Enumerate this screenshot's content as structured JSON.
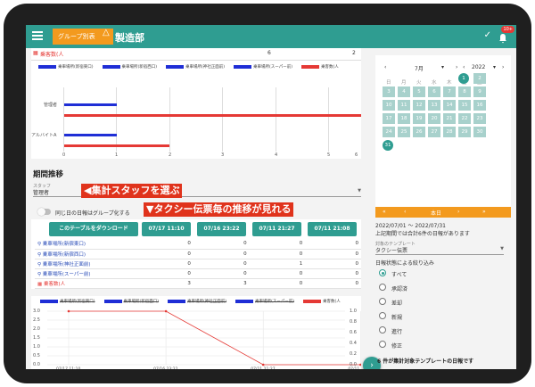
{
  "header": {
    "group_toggle_label": "グループ別表",
    "title": "製造部",
    "notification_count": "10+"
  },
  "top_table": {
    "row_label": "乗客数(人",
    "row_values": [
      "6",
      "2"
    ]
  },
  "bar_chart": {
    "legend": [
      "乗車場所(新宿東口)",
      "乗車場所(新宿西口)",
      "乗車場所(神社正面前)",
      "乗車場所(スーパー前)",
      "乗客数(人"
    ],
    "categories": [
      "管理者",
      "アルバイトA"
    ],
    "x_ticks": [
      "0",
      "1",
      "2",
      "3",
      "4",
      "5",
      "6"
    ]
  },
  "period": {
    "section_title": "期間推移",
    "staff_label": "スタッフ",
    "staff_value": "管理者",
    "callout_staff": "◀集計スタッフを選ぶ",
    "group_same_day_label": "同じ日の日報はグループ化する",
    "callout_trend": "▼タクシー伝票毎の推移が見れる",
    "download_label": "このテーブルをダウンロード",
    "columns": [
      "07/17 11:10",
      "07/16 23:22",
      "07/11 21:27",
      "07/11 21:08"
    ],
    "rows": [
      {
        "label": "乗車場所(新宿東口)",
        "values": [
          "0",
          "0",
          "0",
          "0"
        ]
      },
      {
        "label": "乗車場所(新宿西口)",
        "values": [
          "0",
          "0",
          "0",
          "0"
        ]
      },
      {
        "label": "乗車場所(神社正面前)",
        "values": [
          "0",
          "0",
          "1",
          "0"
        ]
      },
      {
        "label": "乗車場所(スーパー前)",
        "values": [
          "0",
          "0",
          "0",
          "0"
        ]
      },
      {
        "label": "乗客数(人",
        "values": [
          "3",
          "3",
          "0",
          "0"
        ]
      }
    ]
  },
  "line_chart": {
    "legend": [
      "乗車場所(新宿東口)",
      "乗車場所(新宿西口)",
      "乗車場所(神社正面前)",
      "乗車場所(スーパー前)",
      "乗客数(人"
    ],
    "y_left_ticks": [
      "3.0",
      "2.5",
      "2.0",
      "1.5",
      "1.0",
      "0.5",
      "0.0"
    ],
    "y_right_ticks": [
      "1.0",
      "0.8",
      "0.6",
      "0.4",
      "0.2",
      "0.0"
    ],
    "x_ticks": [
      "07/17 11:10",
      "07/16 23:22",
      "07/11 21:27",
      "07/11 21:08"
    ]
  },
  "chart_data": {
    "type": "line",
    "x": [
      "07/17 11:10",
      "07/16 23:22",
      "07/11 21:27",
      "07/11 21:08"
    ],
    "series": [
      {
        "name": "乗客数(人",
        "values": [
          3,
          3,
          0,
          0
        ],
        "color": "#e53935"
      }
    ],
    "ylim": [
      0,
      3
    ]
  },
  "calendar": {
    "month": "7月",
    "year": "2022",
    "weekdays": [
      "日",
      "月",
      "火",
      "水",
      "木",
      "金",
      "土"
    ],
    "days": [
      [
        "",
        "",
        "",
        "",
        "",
        "1",
        "2"
      ],
      [
        "3",
        "4",
        "5",
        "6",
        "7",
        "8",
        "9"
      ],
      [
        "10",
        "11",
        "12",
        "13",
        "14",
        "15",
        "16"
      ],
      [
        "17",
        "18",
        "19",
        "20",
        "21",
        "22",
        "23"
      ],
      [
        "24",
        "25",
        "26",
        "27",
        "28",
        "29",
        "30"
      ],
      [
        "31",
        "",
        "",
        "",
        "",
        "",
        ""
      ]
    ],
    "today_label": "本日",
    "range_text": "2022/07/01 〜 2022/07/31",
    "count_text": "上記期間では合計6件の日報があります",
    "template_label": "対象のテンプレート",
    "template_value": "タクシー伝票",
    "filter_title": "日報状態による絞り込み",
    "filters": [
      "すべて",
      "承認済",
      "差却",
      "新規",
      "進行",
      "修正"
    ],
    "footer": "6 件が集計対象テンプレートの日報です"
  },
  "colors": {
    "teal": "#2f9d91",
    "orange": "#f39a1e",
    "blue": "#1f2ed6",
    "red": "#e53935"
  }
}
